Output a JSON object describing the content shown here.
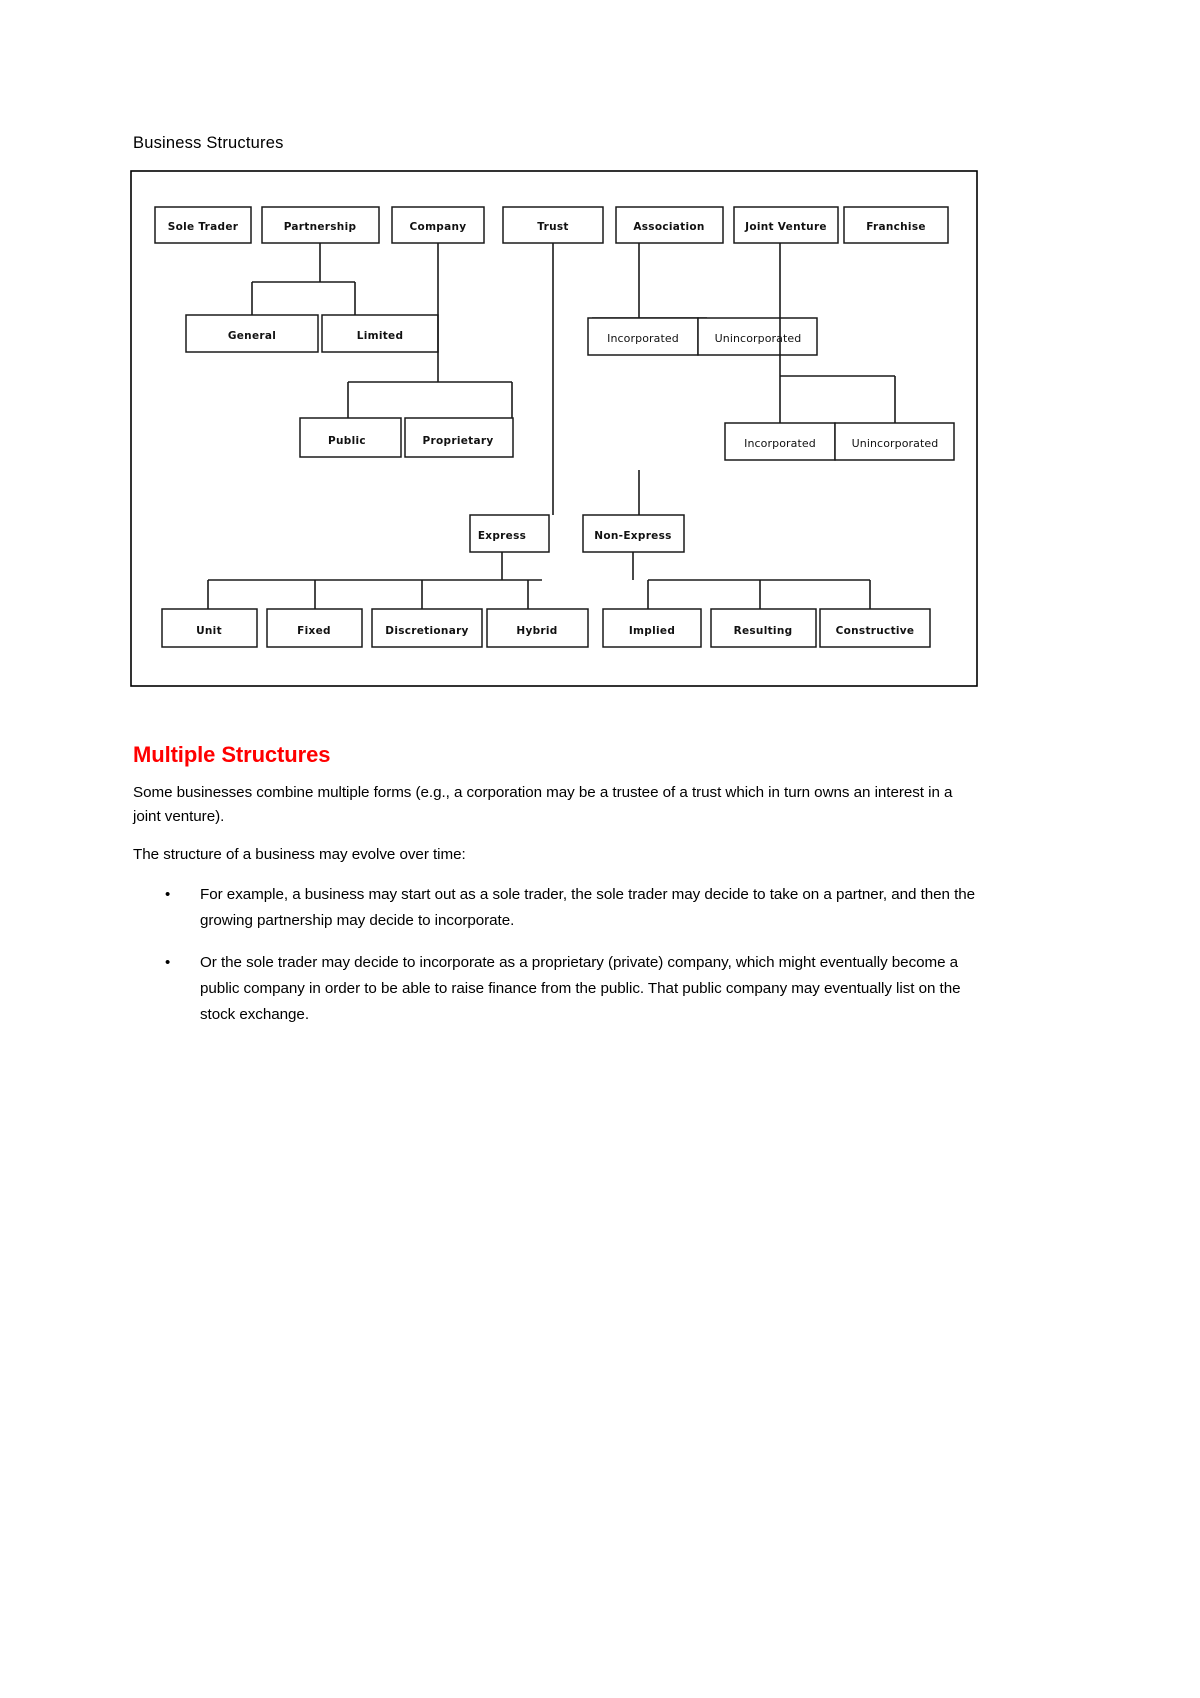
{
  "document": {
    "title": "Business Structures"
  },
  "diagram": {
    "name": "business-structures-tree",
    "tier1": [
      {
        "label": "Sole Trader"
      },
      {
        "label": "Partnership"
      },
      {
        "label": "Company"
      },
      {
        "label": "Trust"
      },
      {
        "label": "Association"
      },
      {
        "label": "Joint Venture"
      },
      {
        "label": "Franchise"
      }
    ],
    "partnership_children": [
      {
        "label": "General"
      },
      {
        "label": "Limited"
      }
    ],
    "company_children": [
      {
        "label": "Public"
      },
      {
        "label": "Proprietary"
      }
    ],
    "association_children": [
      {
        "label": "Incorporated"
      },
      {
        "label": "Unincorporated"
      }
    ],
    "joint_venture_children": [
      {
        "label": "Incorporated"
      },
      {
        "label": "Unincorporated"
      }
    ],
    "trust_children": [
      {
        "label": "Express"
      },
      {
        "label": "Non-Express"
      }
    ],
    "express_children": [
      {
        "label": "Unit"
      },
      {
        "label": "Fixed"
      },
      {
        "label": "Discretionary"
      },
      {
        "label": "Hybrid"
      }
    ],
    "non_express_children": [
      {
        "label": "Implied"
      },
      {
        "label": "Resulting"
      },
      {
        "label": "Constructive"
      }
    ]
  },
  "content": {
    "heading": "Multiple Structures",
    "heading_color": "#FF0000",
    "paragraph_1": "Some businesses combine multiple forms (e.g., a corporation may be a trustee of a trust which in turn owns an interest in a joint venture).",
    "paragraph_2": "The structure of a business may evolve over time:",
    "bullet_char": "•",
    "bullets": [
      "For example, a business may start out as a sole trader, the sole trader may decide to take on a partner, and then the growing partnership may decide to incorporate.",
      "Or the sole trader may decide to incorporate as a proprietary (private) company, which might eventually become a public company in order to be able to raise finance from the public. That public company may eventually list on the stock exchange."
    ]
  }
}
